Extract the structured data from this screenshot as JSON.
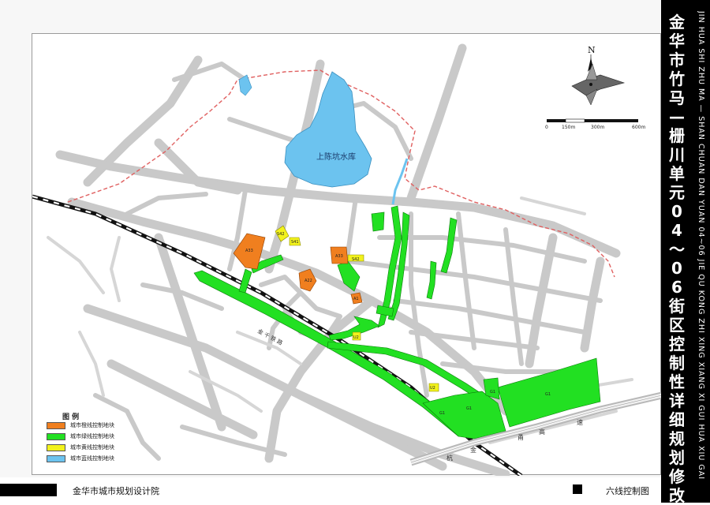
{
  "title": {
    "chinese": "金华市竹马—栅川单元04～06街区控制性详细规划修改",
    "pinyin": "JIN HUA SHI ZHU MA — SHAN CHUAN DAN YUAN 04~06 JIE QU KONG ZHI XING XIANG XI GUI HUA XIU GAI"
  },
  "footer": {
    "organization": "金华市城市规划设计院",
    "drawing_name": "六线控制图"
  },
  "north": {
    "label": "N"
  },
  "scale_bar": {
    "ticks": [
      "0",
      "150m",
      "300m",
      "600m"
    ]
  },
  "legend": {
    "title": "图  例",
    "items": [
      {
        "label": "城市橙线控制地块",
        "color": "#f07f1f"
      },
      {
        "label": "城市绿线控制地块",
        "color": "#22e022"
      },
      {
        "label": "城市黄线控制地块",
        "color": "#f2f21c"
      },
      {
        "label": "城市蓝线控制地块",
        "color": "#6cc3ef"
      }
    ]
  },
  "map_labels": {
    "reservoir": "上陈坑水库",
    "road_jinqian": "金 千 铁 路",
    "road_hang": "杭",
    "road_jin": "金",
    "road_yong": "甬",
    "road_gao": "高",
    "road_su": "速"
  },
  "parcels": {
    "orange_1": "A33",
    "orange_2": "A33",
    "orange_3": "A22",
    "orange_4": "A1",
    "yellow_1": "S42",
    "yellow_2": "S41",
    "yellow_3": "S42",
    "yellow_4": "U2",
    "yellow_5": "U2",
    "green_1": "G1",
    "green_2": "G1",
    "green_3": "G1",
    "green_4": "G1"
  },
  "colors": {
    "orange": "#f07f1f",
    "green": "#22e022",
    "yellow": "#f2f21c",
    "blue": "#6cc3ef",
    "road": "#c9c9c9",
    "boundary": "#e06060"
  }
}
